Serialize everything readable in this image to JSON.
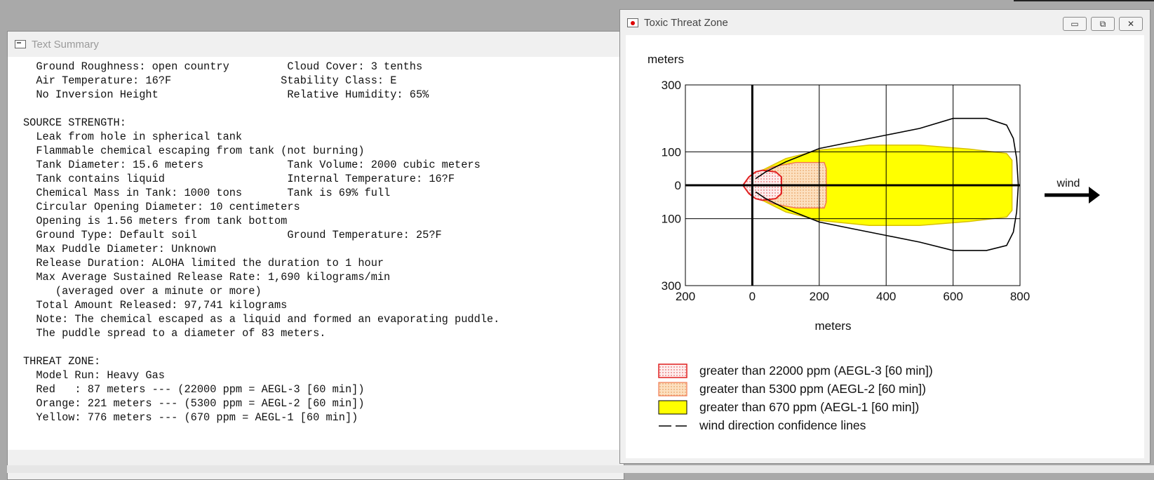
{
  "text_window": {
    "title": "Text Summary",
    "lines": [
      "  Ground Roughness: open country         Cloud Cover: 3 tenths",
      "  Air Temperature: 16?F                 Stability Class: E",
      "  No Inversion Height                    Relative Humidity: 65%",
      "",
      "SOURCE STRENGTH:",
      "  Leak from hole in spherical tank",
      "  Flammable chemical escaping from tank (not burning)",
      "  Tank Diameter: 15.6 meters             Tank Volume: 2000 cubic meters",
      "  Tank contains liquid                   Internal Temperature: 16?F",
      "  Chemical Mass in Tank: 1000 tons       Tank is 69% full",
      "  Circular Opening Diameter: 10 centimeters",
      "  Opening is 1.56 meters from tank bottom",
      "  Ground Type: Default soil              Ground Temperature: 25?F",
      "  Max Puddle Diameter: Unknown",
      "  Release Duration: ALOHA limited the duration to 1 hour",
      "  Max Average Sustained Release Rate: 1,690 kilograms/min",
      "     (averaged over a minute or more)",
      "  Total Amount Released: 97,741 kilograms",
      "  Note: The chemical escaped as a liquid and formed an evaporating puddle.",
      "  The puddle spread to a diameter of 83 meters.",
      "",
      "THREAT ZONE:",
      "  Model Run: Heavy Gas",
      "  Red   : 87 meters --- (22000 ppm = AEGL-3 [60 min])",
      "  Orange: 221 meters --- (5300 ppm = AEGL-2 [60 min])",
      "  Yellow: 776 meters --- (670 ppm = AEGL-1 [60 min])"
    ]
  },
  "chart_window": {
    "title": "Toxic Threat Zone",
    "buttons": {
      "minimize": "▭",
      "restore": "⧉",
      "close": "✕"
    }
  },
  "chart_data": {
    "type": "area",
    "ylabel": "meters",
    "xlabel": "meters",
    "x_ticks": [
      "200",
      "0",
      "200",
      "400",
      "600",
      "800"
    ],
    "x_tick_values": [
      -200,
      0,
      200,
      400,
      600,
      800
    ],
    "y_ticks": [
      "300",
      "100",
      "0",
      "100",
      "300"
    ],
    "y_tick_values": [
      300,
      100,
      0,
      -100,
      -300
    ],
    "xlim": [
      -200,
      800
    ],
    "ylim": [
      -300,
      300
    ],
    "grid": true,
    "wind_label": "wind",
    "zones": [
      {
        "name": "red",
        "color": "#e8302a",
        "fill": "#fbe3e3",
        "threshold": "22000 ppm",
        "distance": 87,
        "outline": [
          [
            87,
            25
          ],
          [
            70,
            40
          ],
          [
            30,
            45
          ],
          [
            10,
            40
          ],
          [
            -10,
            25
          ],
          [
            -28,
            0
          ],
          [
            -10,
            -25
          ],
          [
            10,
            -40
          ],
          [
            30,
            -45
          ],
          [
            70,
            -40
          ],
          [
            87,
            -25
          ]
        ]
      },
      {
        "name": "orange",
        "color": "#f0a050",
        "fill": "#fbd9b2",
        "threshold": "5300 ppm",
        "distance": 221,
        "outline": [
          [
            221,
            50
          ],
          [
            215,
            68
          ],
          [
            130,
            68
          ],
          [
            60,
            55
          ],
          [
            20,
            35
          ],
          [
            5,
            20
          ],
          [
            5,
            -20
          ],
          [
            20,
            -35
          ],
          [
            60,
            -55
          ],
          [
            130,
            -68
          ],
          [
            215,
            -68
          ],
          [
            221,
            -50
          ]
        ]
      },
      {
        "name": "yellow",
        "color": "#e0c800",
        "fill": "#ffff00",
        "threshold": "670 ppm",
        "distance": 776,
        "outline": [
          [
            776,
            75
          ],
          [
            760,
            95
          ],
          [
            650,
            108
          ],
          [
            500,
            120
          ],
          [
            350,
            120
          ],
          [
            200,
            105
          ],
          [
            100,
            80
          ],
          [
            30,
            45
          ],
          [
            10,
            20
          ],
          [
            5,
            0
          ],
          [
            10,
            -20
          ],
          [
            30,
            -45
          ],
          [
            100,
            -80
          ],
          [
            200,
            -105
          ],
          [
            350,
            -120
          ],
          [
            500,
            -120
          ],
          [
            650,
            -108
          ],
          [
            760,
            -95
          ],
          [
            776,
            -75
          ]
        ]
      }
    ],
    "confidence_upper": [
      [
        10,
        20
      ],
      [
        40,
        40
      ],
      [
        100,
        70
      ],
      [
        200,
        110
      ],
      [
        300,
        130
      ],
      [
        400,
        150
      ],
      [
        500,
        170
      ],
      [
        600,
        200
      ],
      [
        700,
        200
      ],
      [
        760,
        180
      ],
      [
        780,
        140
      ],
      [
        790,
        80
      ],
      [
        795,
        0
      ]
    ],
    "confidence_lower": [
      [
        10,
        -20
      ],
      [
        40,
        -40
      ],
      [
        100,
        -70
      ],
      [
        200,
        -110
      ],
      [
        300,
        -130
      ],
      [
        400,
        -150
      ],
      [
        500,
        -170
      ],
      [
        600,
        -195
      ],
      [
        700,
        -195
      ],
      [
        760,
        -180
      ],
      [
        780,
        -140
      ],
      [
        790,
        -80
      ],
      [
        795,
        0
      ]
    ],
    "legend": [
      {
        "label": "greater than 22000 ppm (AEGL-3 [60 min])",
        "swatch": "red"
      },
      {
        "label": "greater than 5300 ppm (AEGL-2 [60 min])",
        "swatch": "orange"
      },
      {
        "label": "greater than 670 ppm (AEGL-1 [60 min])",
        "swatch": "yellow"
      },
      {
        "label": "wind direction confidence lines",
        "swatch": "dash"
      }
    ]
  }
}
